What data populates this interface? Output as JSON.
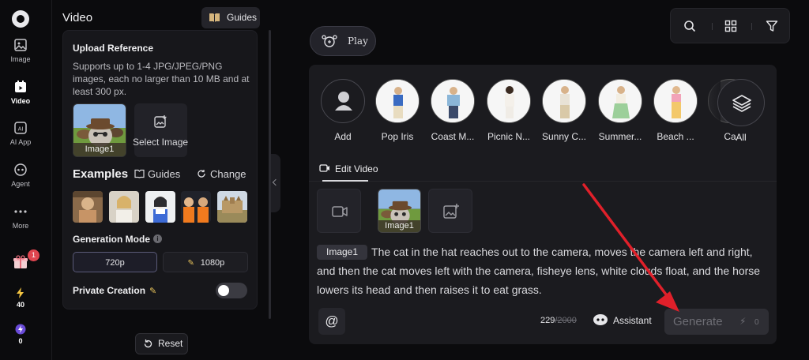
{
  "rail": {
    "items": [
      {
        "label": "Image"
      },
      {
        "label": "Video"
      },
      {
        "label": "AI App"
      },
      {
        "label": "Agent"
      },
      {
        "label": "More"
      }
    ],
    "gift_badge": "1",
    "credits_a": "40",
    "credits_b": "0"
  },
  "panel": {
    "title": "Video",
    "guides_label": "Guides",
    "upload_title": "Upload Reference",
    "upload_desc": "Supports up to 1-4 JPG/JPEG/PNG images, each no larger than 10 MB and at least 300 px.",
    "uploaded_tag": "Image1",
    "select_image": "Select Image",
    "examples_title": "Examples",
    "examples_guides": "Guides",
    "examples_change": "Change",
    "generation_mode": "Generation Mode",
    "res_720": "720p",
    "res_1080": "1080p",
    "private_creation": "Private Creation",
    "reset": "Reset"
  },
  "main": {
    "play_it": "Play It",
    "templates": [
      {
        "label": "Add"
      },
      {
        "label": "Pop Iris"
      },
      {
        "label": "Coast M..."
      },
      {
        "label": "Picnic N..."
      },
      {
        "label": "Sunny C..."
      },
      {
        "label": "Summer..."
      },
      {
        "label": "Beach ..."
      },
      {
        "label": "Ca"
      }
    ],
    "all_label": "All",
    "edit_tab": "Edit Video",
    "slot_tag": "Image1",
    "prompt_chip": "Image1",
    "prompt_text": "The cat in the hat reaches out to the camera, moves the camera left and right, and then the cat moves left with the camera, fisheye lens, white clouds float, and the horse lowers its head and then raises it to eat grass.",
    "count": "229",
    "max_count": "/2000",
    "assistant": "Assistant",
    "generate": "Generate",
    "generate_cost": "0"
  },
  "colors": {
    "accent_arrow": "#e0202a",
    "vip_gold": "#e8c35b",
    "badge_red": "#e0454f"
  }
}
